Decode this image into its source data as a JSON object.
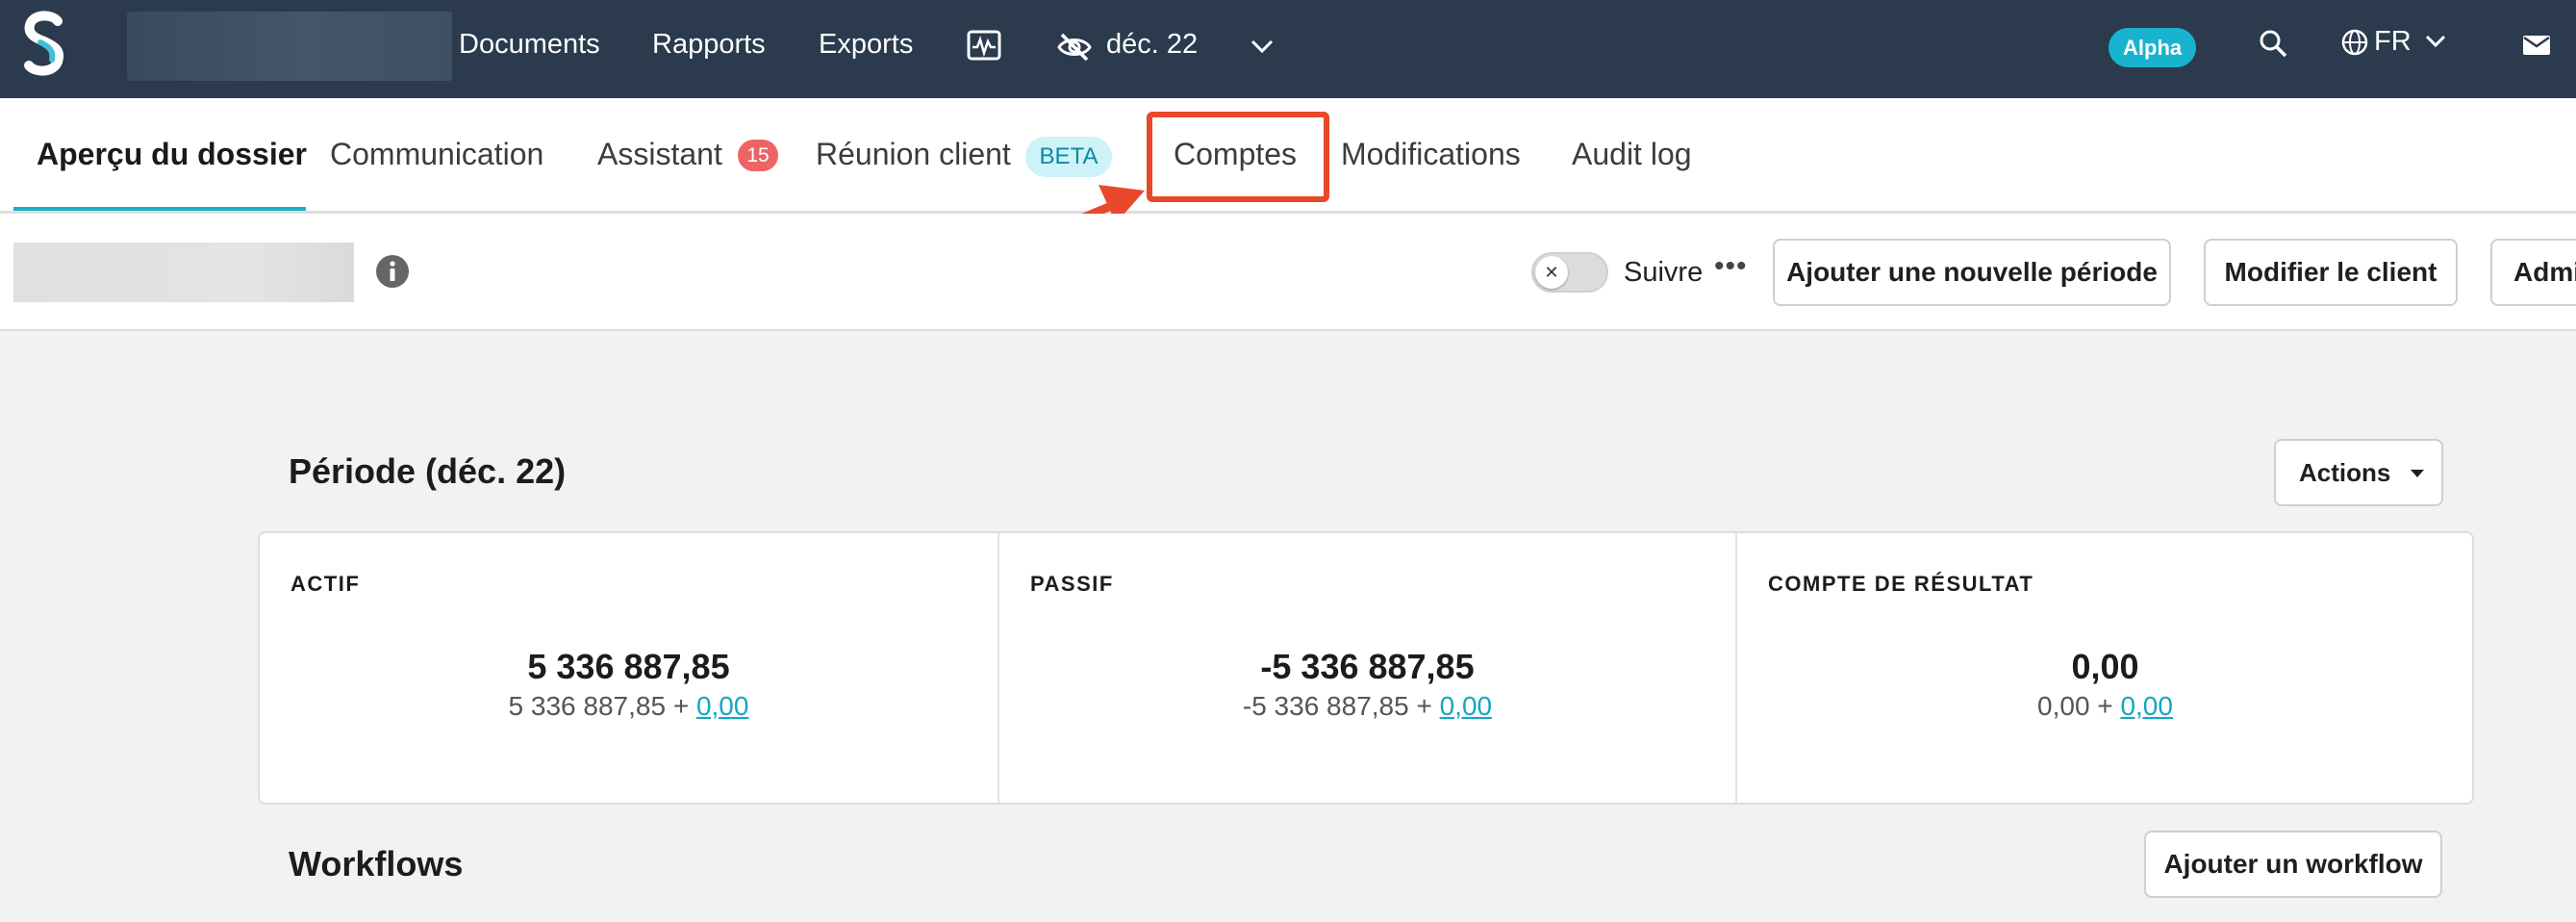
{
  "topbar": {
    "logo_icon": "s-logo",
    "nav": [
      "Documents",
      "Rapports",
      "Exports"
    ],
    "monitor_icon": "activity-monitor-icon",
    "period_label": "déc. 22",
    "period_icon": "eye-off-icon",
    "alpha_badge": "Alpha",
    "language": "FR"
  },
  "tabs": {
    "items": [
      "Aperçu du dossier",
      "Communication",
      "Assistant",
      "Réunion client",
      "Comptes",
      "Modifications",
      "Audit log"
    ],
    "assistant_count": "15",
    "beta_badge": "BETA",
    "active": "Aperçu du dossier",
    "highlighted": "Comptes",
    "highlight_color": "#e8492b",
    "accent_color": "#17b0cb"
  },
  "client_bar": {
    "follow_label": "Suivre",
    "more_label": "•••",
    "buttons": [
      "Ajouter une nouvelle période",
      "Modifier le client",
      "Admi"
    ]
  },
  "main": {
    "period_title": "Période (déc. 22)",
    "actions_label": "Actions",
    "summary": [
      {
        "label": "ACTIF",
        "value": "5 336 887,85",
        "detail": "5 336 887,85 +",
        "link": "0,00"
      },
      {
        "label": "PASSIF",
        "value": "-5 336 887,85",
        "detail": "-5 336 887,85 +",
        "link": "0,00"
      },
      {
        "label": "COMPTE DE RÉSULTAT",
        "value": "0,00",
        "detail": "0,00 +",
        "link": "0,00"
      }
    ],
    "workflows_title": "Workflows",
    "add_workflow_label": "Ajouter un workflow"
  }
}
